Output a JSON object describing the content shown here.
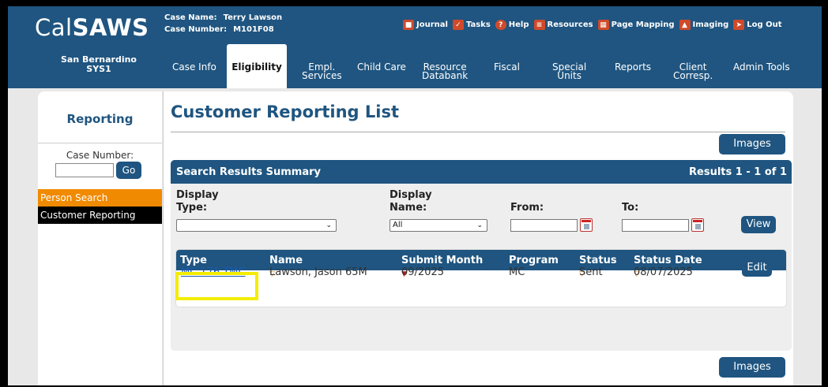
{
  "app": {
    "logo_light": "Cal",
    "logo_bold": "SAWS"
  },
  "case": {
    "name_label": "Case Name:",
    "name_value": "Terry Lawson",
    "number_label": "Case Number:",
    "number_value": "M101F08"
  },
  "top_links": [
    {
      "label": "Journal",
      "icon": "journal-icon",
      "color": "#d9534f"
    },
    {
      "label": "Tasks",
      "icon": "tasks-icon",
      "color": "#d9534f"
    },
    {
      "label": "Help",
      "icon": "help-icon",
      "color": "#d9534f"
    },
    {
      "label": "Resources",
      "icon": "resources-icon",
      "color": "#d9534f"
    },
    {
      "label": "Page Mapping",
      "icon": "page-mapping-icon",
      "color": "#d9534f"
    },
    {
      "label": "Imaging",
      "icon": "imaging-icon",
      "color": "#d9534f"
    },
    {
      "label": "Log Out",
      "icon": "logout-icon",
      "color": "#d9534f"
    }
  ],
  "county": {
    "line1": "San Bernardino",
    "line2": "SYS1"
  },
  "nav": {
    "case_info": "Case Info",
    "eligibility": "Eligibility",
    "empl_1": "Empl.",
    "empl_2": "Services",
    "child_care": "Child Care",
    "resource_1": "Resource",
    "resource_2": "Databank",
    "fiscal": "Fiscal",
    "special_1": "Special",
    "special_2": "Units",
    "reports": "Reports",
    "client_1": "Client",
    "client_2": "Corresp.",
    "admin_tools": "Admin Tools"
  },
  "sidebar": {
    "title": "Reporting",
    "case_number_label": "Case Number:",
    "case_number_value": "",
    "go_label": "Go",
    "items": [
      {
        "label": "Person Search"
      },
      {
        "label": "Customer Reporting"
      }
    ]
  },
  "main": {
    "title": "Customer Reporting List",
    "images_label": "Images",
    "results_title": "Search Results Summary",
    "results_count": "Results 1 - 1 of 1",
    "filters": {
      "display_type_label_1": "Display",
      "display_type_label_2": "Type:",
      "display_type_value": "",
      "display_name_label_1": "Display",
      "display_name_label_2": "Name:",
      "display_name_value": "All",
      "from_label": "From:",
      "from_value": "",
      "to_label": "To:",
      "to_value": "",
      "view_label": "View"
    },
    "table": {
      "columns": [
        "Type",
        "Name",
        "Submit Month",
        "Program",
        "Status",
        "Status Date"
      ],
      "rows": [
        {
          "type": "MC 176 TMC",
          "name": "Lawson, Jason 65M",
          "submit_month": "09/2025",
          "program": "MC",
          "status": "Sent",
          "status_date": "08/07/2025",
          "edit_label": "Edit"
        }
      ]
    }
  },
  "colors": {
    "brand": "#1f5580",
    "active_menu": "#f08a00",
    "highlight": "#f4ec00"
  }
}
